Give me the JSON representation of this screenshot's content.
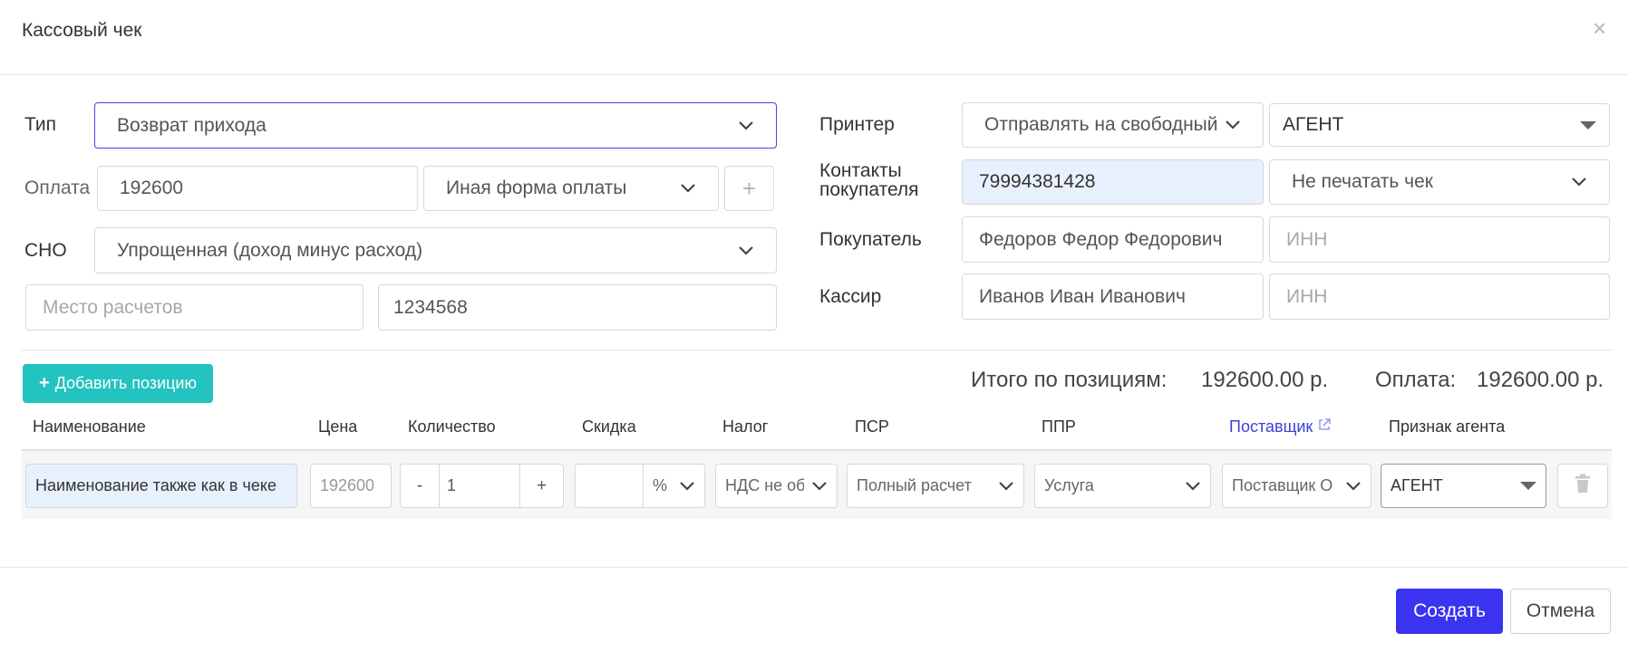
{
  "dialog": {
    "title": "Кассовый чек"
  },
  "form": {
    "type_label": "Тип",
    "type_value": "Возврат прихода",
    "payment_label": "Оплата",
    "payment_amount": "192600",
    "payment_method": "Иная форма оплаты",
    "sno_label": "СНО",
    "sno_value": "Упрощенная (доход минус расход)",
    "place_placeholder": "Место расчетов",
    "place_number": "1234568",
    "printer_label": "Принтер",
    "printer_value": "Отправлять на свободный",
    "agent_value": "АГЕНТ",
    "contacts_label_1": "Контакты",
    "contacts_label_2": "покупателя",
    "contacts_value": "79994381428",
    "print_mode": "Не печатать чек",
    "buyer_label": "Покупатель",
    "buyer_value": "Федоров Федор Федорович",
    "buyer_inn_placeholder": "ИНН",
    "cashier_label": "Кассир",
    "cashier_value": "Иванов Иван Иванович",
    "cashier_inn_placeholder": "ИНН"
  },
  "positions": {
    "add_label": "Добавить позицию",
    "total_positions_label": "Итого по позициям:",
    "total_positions_value": "192600.00 р.",
    "total_payment_label": "Оплата:",
    "total_payment_value": "192600.00 р.",
    "columns": {
      "name": "Наименование",
      "price": "Цена",
      "qty": "Количество",
      "discount": "Скидка",
      "tax": "Налог",
      "psr": "ПСР",
      "ppr": "ППР",
      "supplier": "Поставщик",
      "agent": "Признак агента"
    },
    "row": {
      "name": "Наименование также как в чеке",
      "price": "192600",
      "qty_minus": "-",
      "qty": "1",
      "qty_plus": "+",
      "discount": "",
      "discount_unit": "%",
      "tax": "НДС не облагается",
      "psr": "Полный расчет",
      "ppr": "Услуга",
      "supplier": "Поставщик О",
      "agent": "АГЕНТ"
    }
  },
  "footer": {
    "create_label": "Создать",
    "cancel_label": "Отмена"
  },
  "colors": {
    "accent": "#3a33f0",
    "teal": "#22c3c0",
    "link": "#3b42d4",
    "active_border": "#5046e4"
  }
}
